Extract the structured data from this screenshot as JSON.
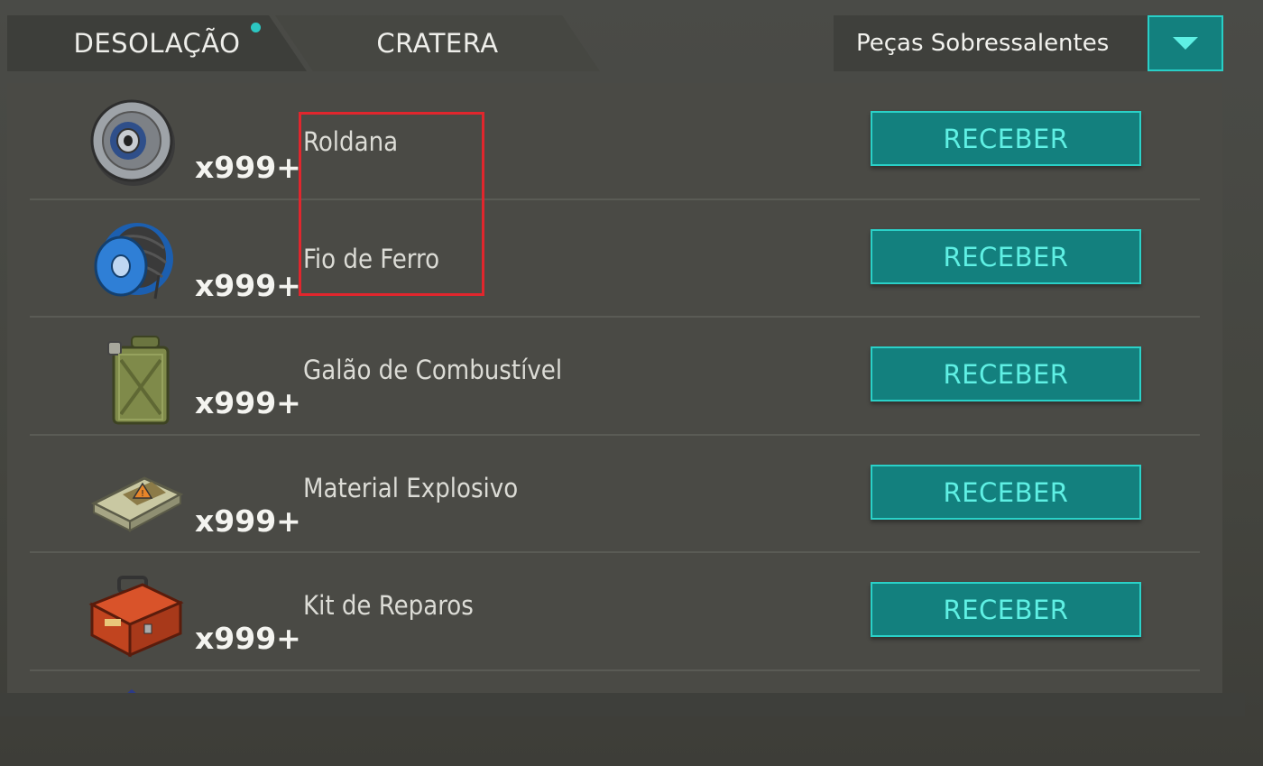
{
  "tabs": [
    {
      "label": "DESOLAÇÃO",
      "has_notification": true
    },
    {
      "label": "CRATERA",
      "has_notification": false
    }
  ],
  "dropdown": {
    "selected": "Peças Sobressalentes"
  },
  "items": [
    {
      "name": "Roldana",
      "quantity": "x999+",
      "button": "RECEBER",
      "icon": "pulley-icon"
    },
    {
      "name": "Fio de Ferro",
      "quantity": "x999+",
      "button": "RECEBER",
      "icon": "wire-spool-icon"
    },
    {
      "name": "Galão de Combustível",
      "quantity": "x999+",
      "button": "RECEBER",
      "icon": "jerrycan-icon"
    },
    {
      "name": "Material Explosivo",
      "quantity": "x999+",
      "button": "RECEBER",
      "icon": "explosive-icon"
    },
    {
      "name": "Kit de Reparos",
      "quantity": "x999+",
      "button": "RECEBER",
      "icon": "toolbox-icon"
    }
  ],
  "colors": {
    "accent": "#13807e",
    "accent_border": "#2ad1c8",
    "highlight": "#e1262d"
  }
}
